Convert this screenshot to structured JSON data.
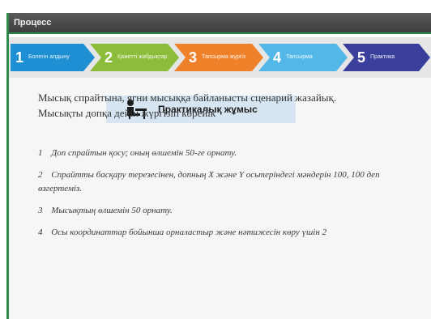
{
  "window": {
    "title": "Процесс"
  },
  "steps": [
    {
      "num": "1",
      "label": "Болегін  алдыну",
      "color": "#1f8fd3"
    },
    {
      "num": "2",
      "label": "Қажетті  жабдықтар",
      "color": "#8bbd3a"
    },
    {
      "num": "3",
      "label": "Тапсырма  жүргіз",
      "color": "#f0812b"
    },
    {
      "num": "4",
      "label": "Тапсырма",
      "color": "#53b7e8"
    },
    {
      "num": "5",
      "label": "Практика",
      "color": "#3a3f9c"
    }
  ],
  "banner": {
    "title": "Практикалық жұмыс",
    "icon": "student-at-desk-icon"
  },
  "content": {
    "intro_line1": "Мысық спрайтына, ягни мысыққа байланысты сценарий жазайық.",
    "intro_line2": "Мысықты допқа дейін жүргізіп көрейік",
    "tasks": [
      {
        "n": "1",
        "text": "Доп спрайтын қосу; оның өлшемін 50-ге орнату."
      },
      {
        "n": "2",
        "text": "Спрайтты басқару терезесінен, допның Х және Y осьтеріндегі мәндерін 100, 100 деп өзгертеміз."
      },
      {
        "n": "3",
        "text": "Мысықтың өлшемін 50 орнату."
      },
      {
        "n": "4",
        "text": "Осы координаттар бойынша орналастыр және нәтижесін көру үшін 2"
      }
    ]
  }
}
